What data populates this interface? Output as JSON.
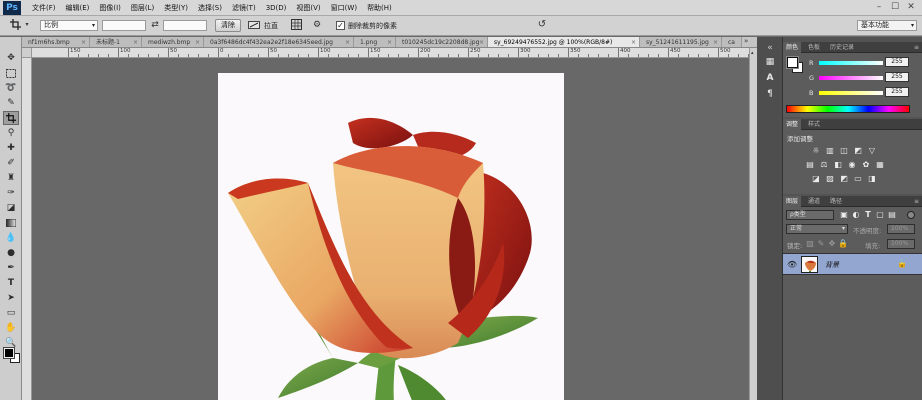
{
  "app": {
    "logo": "Ps"
  },
  "menu": [
    "文件(F)",
    "编辑(E)",
    "图像(I)",
    "图层(L)",
    "类型(Y)",
    "选择(S)",
    "滤镜(T)",
    "3D(D)",
    "视图(V)",
    "窗口(W)",
    "帮助(H)"
  ],
  "window_controls": [
    "–",
    "☐",
    "✕"
  ],
  "options": {
    "ratio": "比例",
    "clear": "清除",
    "straighten": "拉直",
    "delete_cropped": "删除裁剪的像素",
    "delete_cropped_checked": true,
    "workspace": "基本功能"
  },
  "tabs": [
    {
      "label": "nf1m6hs.bmp",
      "active": false
    },
    {
      "label": "未标题-1",
      "active": false
    },
    {
      "label": "mediwzh.bmp",
      "active": false
    },
    {
      "label": "0a3f6486dc4f432ea2e2f18e6345eed.jpg",
      "active": false
    },
    {
      "label": "1.png",
      "active": false
    },
    {
      "label": "t010245dc19c2208d8.jpg",
      "active": false
    },
    {
      "label": "sy_69249476552.jpg @ 100%(RGB/8#)",
      "active": true
    },
    {
      "label": "sy_51241611195.jpg",
      "active": false
    },
    {
      "label": "ca",
      "active": false
    }
  ],
  "ruler_labels": [
    "300",
    "250",
    "200",
    "150",
    "100",
    "50",
    "0",
    "50",
    "100",
    "150",
    "200",
    "250",
    "300",
    "350",
    "400",
    "450",
    "500",
    "550",
    "600",
    "650",
    "700",
    "750",
    "800"
  ],
  "panel_tabs_color": [
    "颜色",
    "色板",
    "历史记录"
  ],
  "color": {
    "r_label": "R",
    "g_label": "G",
    "b_label": "B",
    "r": "255",
    "g": "255",
    "b": "255"
  },
  "panel_tabs_adjust": [
    "调整",
    "样式"
  ],
  "adjust_title": "添加调整",
  "panel_tabs_layers": [
    "图层",
    "通道",
    "路径"
  ],
  "layers": {
    "filter_kind": "ρ类型",
    "blend_mode": "正常",
    "opacity_label": "不透明度:",
    "opacity": "100%",
    "lock_label": "锁定:",
    "fill_label": "填充:",
    "fill": "100%",
    "layer_name": "背景"
  },
  "colors": {
    "accent": "#93a6cf",
    "panel": "#535353",
    "canvas": "#686868"
  }
}
